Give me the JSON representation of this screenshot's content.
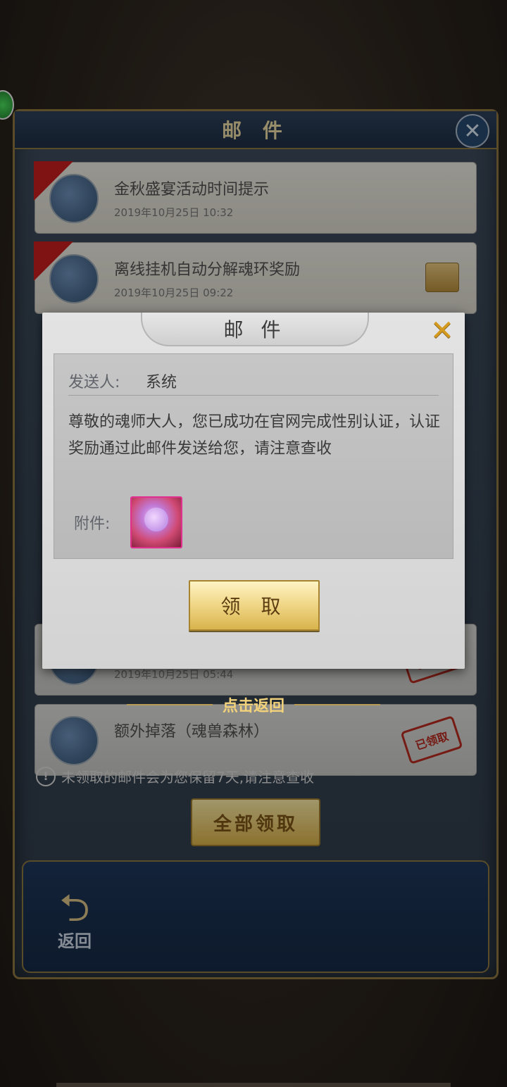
{
  "background": {
    "title": "邮 件",
    "mails": [
      {
        "title": "金秋盛宴活动时间提示",
        "date": "2019年10月25日 10:32",
        "unread": true
      },
      {
        "title": "离线挂机自动分解魂环奖励",
        "date": "2019年10月25日 09:22",
        "unread": true
      },
      {
        "title": "",
        "date": "2019年10月25日 05:44",
        "stamp": "已领取"
      },
      {
        "title": "额外掉落（魂兽森林）",
        "date": "",
        "stamp": "已领取"
      }
    ],
    "notice": "未领取的邮件会为您保留7天,请注意查收",
    "collect_all": "全部领取",
    "back_label": "返回"
  },
  "dialog": {
    "title": "邮 件",
    "sender_label": "发送人:",
    "sender": "系统",
    "message": "尊敬的魂师大人，您已成功在官网完成性别认证，认证奖励通过此邮件发送给您，请注意查收",
    "attachment_label": "附件:",
    "claim_label": "领 取"
  },
  "return_hint": "点击返回",
  "colors": {
    "accent_gold": "#f2d27a",
    "claim_button": "#f1d98b",
    "dialog_bg": "#d9d9d9"
  }
}
